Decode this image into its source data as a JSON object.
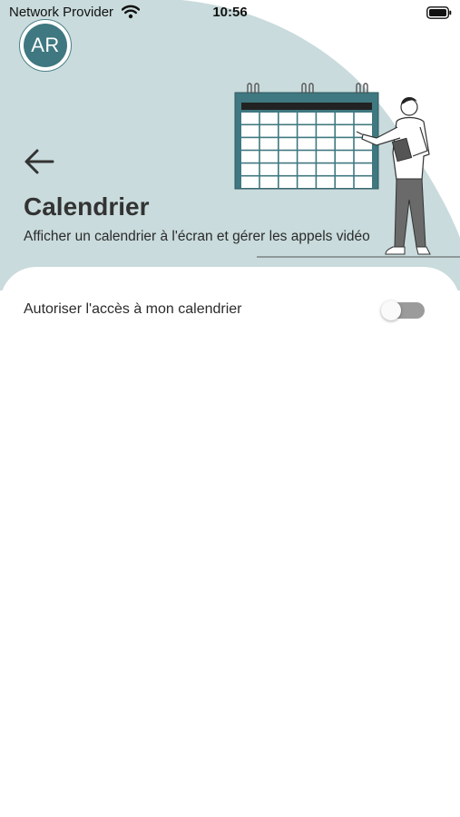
{
  "status_bar": {
    "carrier": "Network Provider",
    "time": "10:56",
    "wifi_icon": "wifi-icon",
    "battery_icon": "battery-icon"
  },
  "avatar": {
    "initials": "AR"
  },
  "header": {
    "back_icon": "arrow-left-icon",
    "title": "Calendrier",
    "subtitle": "Afficher un calendrier à l'écran et gérer les appels vidéo",
    "illustration": "calendar-presenter-illustration"
  },
  "settings": [
    {
      "label": "Autoriser l'accès à mon calendrier",
      "enabled": false
    }
  ],
  "colors": {
    "header_blob": "#c9dbdc",
    "accent": "#3f7880",
    "calendar": "#3f7880",
    "toggle_track": "#9b9b9b"
  }
}
